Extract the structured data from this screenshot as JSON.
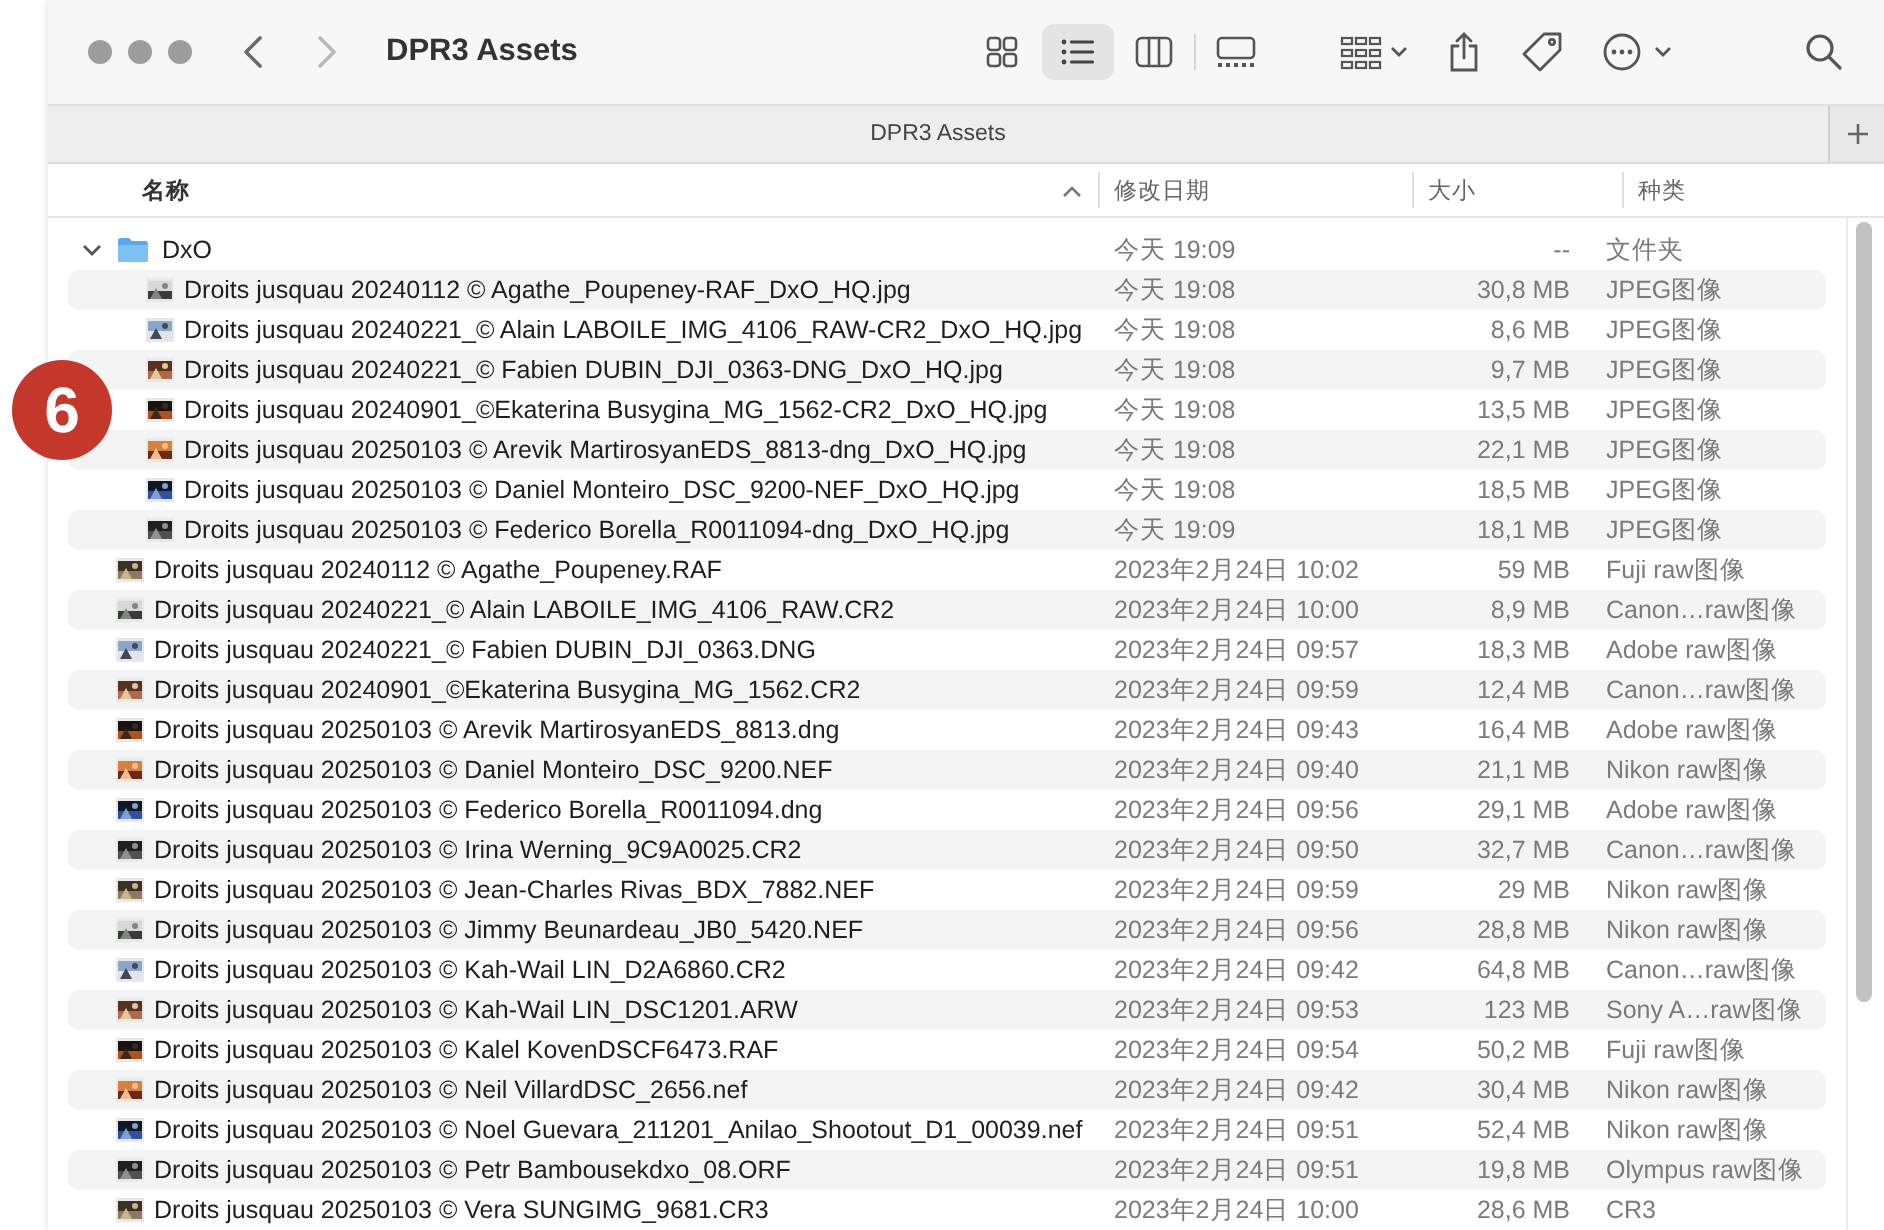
{
  "window": {
    "title": "DPR3 Assets",
    "forward_disabled": true
  },
  "views": [
    {
      "kind": "icons",
      "selected": false
    },
    {
      "kind": "list",
      "selected": true
    },
    {
      "kind": "columns",
      "selected": false
    },
    {
      "kind": "gallery",
      "selected": false
    }
  ],
  "tab": {
    "label": "DPR3 Assets"
  },
  "columns": [
    {
      "label": "名称",
      "sorted": true
    },
    {
      "label": "修改日期",
      "sorted": false
    },
    {
      "label": "大小",
      "sorted": false
    },
    {
      "label": "种类",
      "sorted": false
    }
  ],
  "rows": [
    {
      "kind": "folder",
      "name": "DxO",
      "date": "今天 19:09",
      "size": "--",
      "type": "文件夹",
      "expanded": true,
      "children": [
        {
          "kind": "file",
          "name": "Droits jusquau 20240112 © Agathe_Poupeney-RAF_DxO_HQ.jpg",
          "date": "今天 19:08",
          "size": "30,8 MB",
          "type": "JPEG图像"
        },
        {
          "kind": "file",
          "name": "Droits jusquau 20240221_© Alain LABOILE_IMG_4106_RAW-CR2_DxO_HQ.jpg",
          "date": "今天 19:08",
          "size": "8,6 MB",
          "type": "JPEG图像"
        },
        {
          "kind": "file",
          "name": "Droits jusquau 20240221_© Fabien DUBIN_DJI_0363-DNG_DxO_HQ.jpg",
          "date": "今天 19:08",
          "size": "9,7 MB",
          "type": "JPEG图像"
        },
        {
          "kind": "file",
          "name": "Droits jusquau 20240901_©Ekaterina Busygina_MG_1562-CR2_DxO_HQ.jpg",
          "date": "今天 19:08",
          "size": "13,5 MB",
          "type": "JPEG图像"
        },
        {
          "kind": "file",
          "name": "Droits jusquau 20250103 © Arevik MartirosyanEDS_8813-dng_DxO_HQ.jpg",
          "date": "今天 19:08",
          "size": "22,1 MB",
          "type": "JPEG图像"
        },
        {
          "kind": "file",
          "name": "Droits jusquau 20250103 © Daniel Monteiro_DSC_9200-NEF_DxO_HQ.jpg",
          "date": "今天 19:08",
          "size": "18,5 MB",
          "type": "JPEG图像"
        },
        {
          "kind": "file",
          "name": "Droits jusquau 20250103 © Federico Borella_R0011094-dng_DxO_HQ.jpg",
          "date": "今天 19:09",
          "size": "18,1 MB",
          "type": "JPEG图像"
        }
      ]
    },
    {
      "kind": "file",
      "name": "Droits jusquau 20240112 © Agathe_Poupeney.RAF",
      "date": "2023年2月24日 10:02",
      "size": "59 MB",
      "type": "Fuji raw图像"
    },
    {
      "kind": "file",
      "name": "Droits jusquau 20240221_© Alain LABOILE_IMG_4106_RAW.CR2",
      "date": "2023年2月24日 10:00",
      "size": "8,9 MB",
      "type": "Canon…raw图像"
    },
    {
      "kind": "file",
      "name": "Droits jusquau 20240221_© Fabien DUBIN_DJI_0363.DNG",
      "date": "2023年2月24日 09:57",
      "size": "18,3 MB",
      "type": "Adobe raw图像"
    },
    {
      "kind": "file",
      "name": "Droits jusquau 20240901_©Ekaterina Busygina_MG_1562.CR2",
      "date": "2023年2月24日 09:59",
      "size": "12,4 MB",
      "type": "Canon…raw图像"
    },
    {
      "kind": "file",
      "name": "Droits jusquau 20250103 © Arevik MartirosyanEDS_8813.dng",
      "date": "2023年2月24日 09:43",
      "size": "16,4 MB",
      "type": "Adobe raw图像"
    },
    {
      "kind": "file",
      "name": "Droits jusquau 20250103 © Daniel Monteiro_DSC_9200.NEF",
      "date": "2023年2月24日 09:40",
      "size": "21,1 MB",
      "type": "Nikon raw图像"
    },
    {
      "kind": "file",
      "name": "Droits jusquau 20250103 © Federico Borella_R0011094.dng",
      "date": "2023年2月24日 09:56",
      "size": "29,1 MB",
      "type": "Adobe raw图像"
    },
    {
      "kind": "file",
      "name": "Droits jusquau 20250103 © Irina Werning_9C9A0025.CR2",
      "date": "2023年2月24日 09:50",
      "size": "32,7 MB",
      "type": "Canon…raw图像"
    },
    {
      "kind": "file",
      "name": "Droits jusquau 20250103 © Jean-Charles Rivas_BDX_7882.NEF",
      "date": "2023年2月24日 09:59",
      "size": "29 MB",
      "type": "Nikon raw图像"
    },
    {
      "kind": "file",
      "name": "Droits jusquau 20250103 © Jimmy Beunardeau_JB0_5420.NEF",
      "date": "2023年2月24日 09:56",
      "size": "28,8 MB",
      "type": "Nikon raw图像"
    },
    {
      "kind": "file",
      "name": "Droits jusquau 20250103 © Kah-Wail LIN_D2A6860.CR2",
      "date": "2023年2月24日 09:42",
      "size": "64,8 MB",
      "type": "Canon…raw图像"
    },
    {
      "kind": "file",
      "name": "Droits jusquau 20250103 © Kah-Wail LIN_DSC1201.ARW",
      "date": "2023年2月24日 09:53",
      "size": "123 MB",
      "type": "Sony A…raw图像"
    },
    {
      "kind": "file",
      "name": "Droits jusquau 20250103 © Kalel KovenDSCF6473.RAF",
      "date": "2023年2月24日 09:54",
      "size": "50,2 MB",
      "type": "Fuji raw图像"
    },
    {
      "kind": "file",
      "name": "Droits jusquau 20250103 © Neil VillardDSC_2656.nef",
      "date": "2023年2月24日 09:42",
      "size": "30,4 MB",
      "type": "Nikon raw图像"
    },
    {
      "kind": "file",
      "name": "Droits jusquau 20250103 © Noel Guevara_211201_Anilao_Shootout_D1_00039.nef",
      "date": "2023年2月24日 09:51",
      "size": "52,4 MB",
      "type": "Nikon raw图像"
    },
    {
      "kind": "file",
      "name": "Droits jusquau 20250103 © Petr Bambousekdxo_08.ORF",
      "date": "2023年2月24日 09:51",
      "size": "19,8 MB",
      "type": "Olympus raw图像"
    },
    {
      "kind": "file",
      "name": "Droits jusquau 20250103 © Vera SUNGIMG_9681.CR3",
      "date": "2023年2月24日 10:00",
      "size": "28,6 MB",
      "type": "CR3"
    }
  ],
  "badge": {
    "label": "6"
  }
}
